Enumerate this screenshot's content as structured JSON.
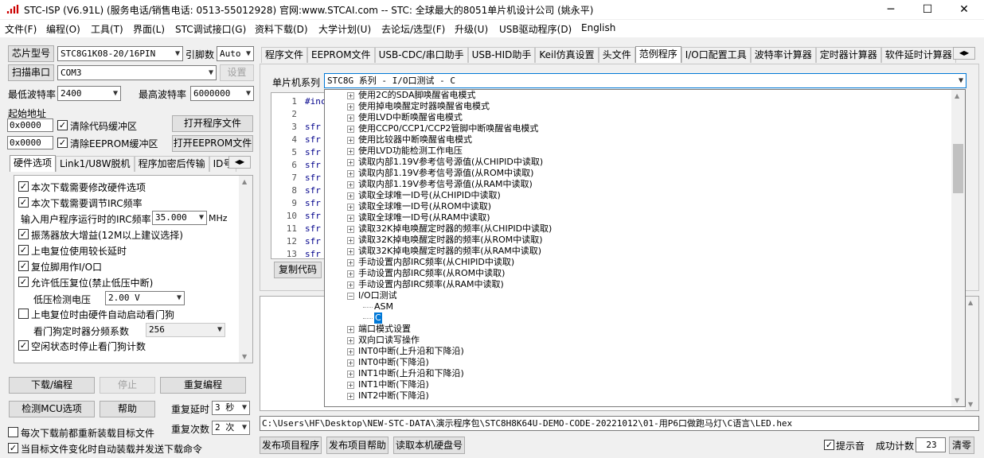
{
  "title": "STC-ISP (V6.91L) (服务电话/销售电话: 0513-55012928) 官网:www.STCAI.com  -- STC: 全球最大的8051单片机设计公司 (姚永平)",
  "window": {
    "minimize": "─",
    "maximize": "☐",
    "close": "✕"
  },
  "menu": [
    "文件(F)",
    "编程(O)",
    "工具(T)",
    "界面(L)",
    "STC调试接口(G)",
    "资料下载(D)",
    "大学计划(U)",
    "去论坛/选型(F)",
    "升级(U)",
    "USB驱动程序(D)",
    "English"
  ],
  "left": {
    "chip_label": "芯片型号",
    "chip_value": "STC8G1K08-20/16PIN",
    "pins_label": "引脚数",
    "pins_value": "Auto",
    "scan_button": "扫描串口",
    "port_value": "COM3",
    "settings_button": "设置",
    "min_baud_label": "最低波特率",
    "min_baud_value": "2400",
    "max_baud_label": "最高波特率",
    "max_baud_value": "6000000",
    "start_addr_label": "起始地址",
    "addr1": "0x0000",
    "clear_code": "清除代码缓冲区",
    "open_prog": "打开程序文件",
    "addr2": "0x0000",
    "clear_eeprom": "清除EEPROM缓冲区",
    "open_eeprom": "打开EEPROM文件",
    "tabs": [
      "硬件选项",
      "Link1/U8W脱机",
      "程序加密后传输",
      "ID号"
    ],
    "hw": {
      "opt1": "本次下载需要修改硬件选项",
      "opt2": "本次下载需要调节IRC频率",
      "irc_label": "输入用户程序运行时的IRC频率",
      "irc_value": "35.000",
      "irc_unit": "MHz",
      "opt3": "振荡器放大增益(12M以上建议选择)",
      "opt4": "上电复位使用较长延时",
      "opt5": "复位脚用作I/O口",
      "opt6": "允许低压复位(禁止低压中断)",
      "lv_label": "低压检测电压",
      "lv_value": "2.00 V",
      "opt7": "上电复位时由硬件自动启动看门狗",
      "wdt_label": "看门狗定时器分频系数",
      "wdt_value": "256",
      "opt8": "空闲状态时停止看门狗计数"
    },
    "download": "下载/编程",
    "stop": "停止",
    "reprogram": "重复编程",
    "check_mcu": "检测MCU选项",
    "help": "帮助",
    "retry_delay_label": "重复延时",
    "retry_delay_value": "3 秒",
    "retry_count_label": "重复次数",
    "retry_count_value": "2 次",
    "reload1": "每次下载前都重新装载目标文件",
    "reload2": "当目标文件变化时自动装载并发送下载命令"
  },
  "right": {
    "tabs": [
      "程序文件",
      "EEPROM文件",
      "USB-CDC/串口助手",
      "USB-HID助手",
      "Keil仿真设置",
      "头文件",
      "范例程序",
      "I/O口配置工具",
      "波特率计算器",
      "定时器计算器",
      "软件延时计算器"
    ],
    "series_label": "单片机系列",
    "series_value": "STC8G 系列 - I/O口测试 - C",
    "code_lines": [
      "1",
      "2",
      "3",
      "4",
      "5",
      "6",
      "7",
      "8",
      "9",
      "10",
      "11",
      "12",
      "13"
    ],
    "code_text": [
      "#inc",
      "",
      "sfr",
      "sfr",
      "sfr",
      "sfr",
      "sfr",
      "sfr",
      "sfr",
      "sfr",
      "sfr",
      "sfr",
      "sfr"
    ],
    "copy_button": "复制代码",
    "path": "C:\\Users\\HF\\Desktop\\NEW-STC-DATA\\演示程序包\\STC8H8K64U-DEMO-CODE-20221012\\01-用P6口做跑马灯\\C语言\\LED.hex",
    "publish_prog": "发布项目程序",
    "publish_help": "发布项目帮助",
    "read_disk": "读取本机硬盘号",
    "beep": "提示音",
    "success_label": "成功计数",
    "success_value": "23",
    "clear": "清零"
  },
  "tree": [
    {
      "text": "使用2C的SDA脚唤醒省电模式",
      "type": "node"
    },
    {
      "text": "使用掉电唤醒定时器唤醒省电模式",
      "type": "node"
    },
    {
      "text": "使用LVD中断唤醒省电模式",
      "type": "node"
    },
    {
      "text": "使用CCP0/CCP1/CCP2管脚中断唤醒省电模式",
      "type": "node"
    },
    {
      "text": "使用比较器中断唤醒省电模式",
      "type": "node"
    },
    {
      "text": "使用LVD功能检测工作电压",
      "type": "node"
    },
    {
      "text": "读取内部1.19V参考信号源值(从CHIPID中读取)",
      "type": "node"
    },
    {
      "text": "读取内部1.19V参考信号源值(从ROM中读取)",
      "type": "node"
    },
    {
      "text": "读取内部1.19V参考信号源值(从RAM中读取)",
      "type": "node"
    },
    {
      "text": "读取全球唯一ID号(从CHIPID中读取)",
      "type": "node"
    },
    {
      "text": "读取全球唯一ID号(从ROM中读取)",
      "type": "node"
    },
    {
      "text": "读取全球唯一ID号(从RAM中读取)",
      "type": "node"
    },
    {
      "text": "读取32K掉电唤醒定时器的频率(从CHIPID中读取)",
      "type": "node"
    },
    {
      "text": "读取32K掉电唤醒定时器的频率(从ROM中读取)",
      "type": "node"
    },
    {
      "text": "读取32K掉电唤醒定时器的频率(从RAM中读取)",
      "type": "node"
    },
    {
      "text": "手动设置内部IRC频率(从CHIPID中读取)",
      "type": "node"
    },
    {
      "text": "手动设置内部IRC频率(从ROM中读取)",
      "type": "node"
    },
    {
      "text": "手动设置内部IRC频率(从RAM中读取)",
      "type": "node"
    },
    {
      "text": "I/O口测试",
      "type": "open"
    },
    {
      "text": "ASM",
      "type": "leaf"
    },
    {
      "text": "C",
      "type": "leafsel"
    },
    {
      "text": "端口模式设置",
      "type": "node"
    },
    {
      "text": "双向口读写操作",
      "type": "node"
    },
    {
      "text": "INT0中断(上升沿和下降沿)",
      "type": "node"
    },
    {
      "text": "INT0中断(下降沿)",
      "type": "node"
    },
    {
      "text": "INT1中断(上升沿和下降沿)",
      "type": "node"
    },
    {
      "text": "INT1中断(下降沿)",
      "type": "node"
    },
    {
      "text": "INT2中断(下降沿)",
      "type": "node"
    }
  ],
  "colors": {
    "selection": "#0078d7",
    "code_keyword": "#00008b",
    "line_number": "#555555"
  }
}
